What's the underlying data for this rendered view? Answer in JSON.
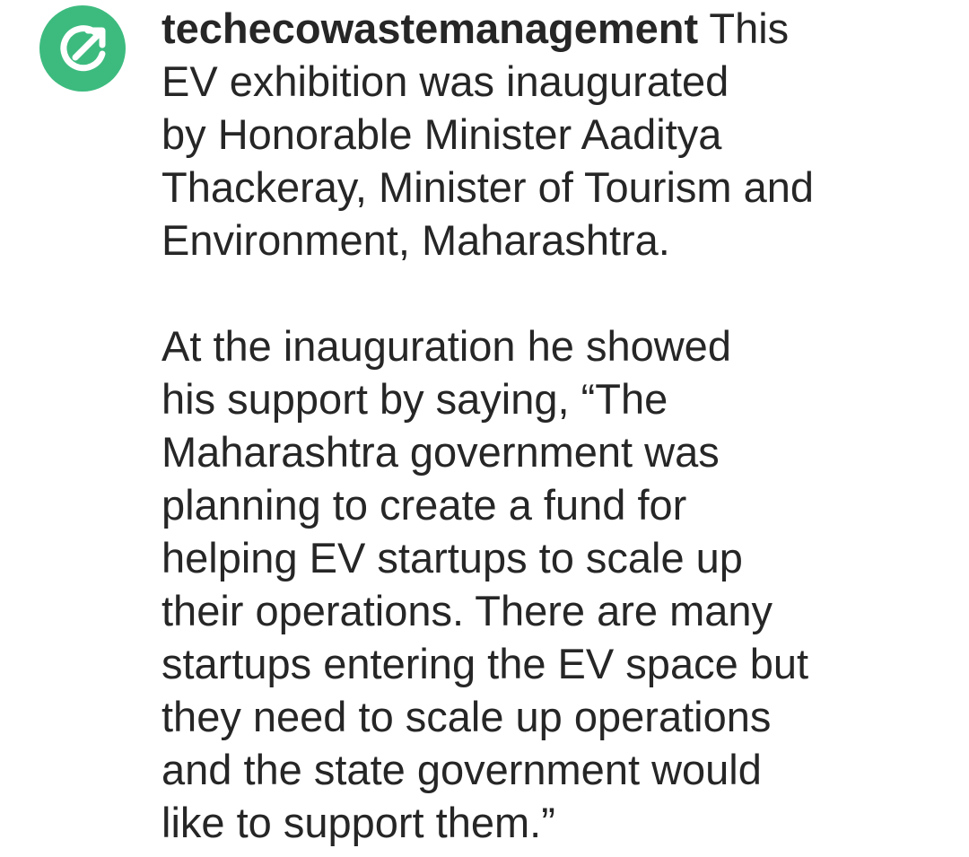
{
  "post": {
    "avatar_icon": "share-arrow-icon",
    "avatar_color": "#3dbb7f",
    "username": "techecowastemanagement",
    "caption_p1_lines": [
      "This",
      "EV exhibition was inaugurated",
      "by Honorable Minister Aaditya",
      "Thackeray, Minister of Tourism and",
      "Environment, Maharashtra."
    ],
    "caption_p2_lines": [
      "At the inauguration he showed",
      "his support by saying, “The",
      "Maharashtra government was",
      "planning to create a fund for",
      "helping EV startups to scale up",
      "their operations. There are many",
      "startups entering the EV space but",
      "they need to scale up operations",
      "and the state government would",
      "like to support them.”"
    ]
  }
}
